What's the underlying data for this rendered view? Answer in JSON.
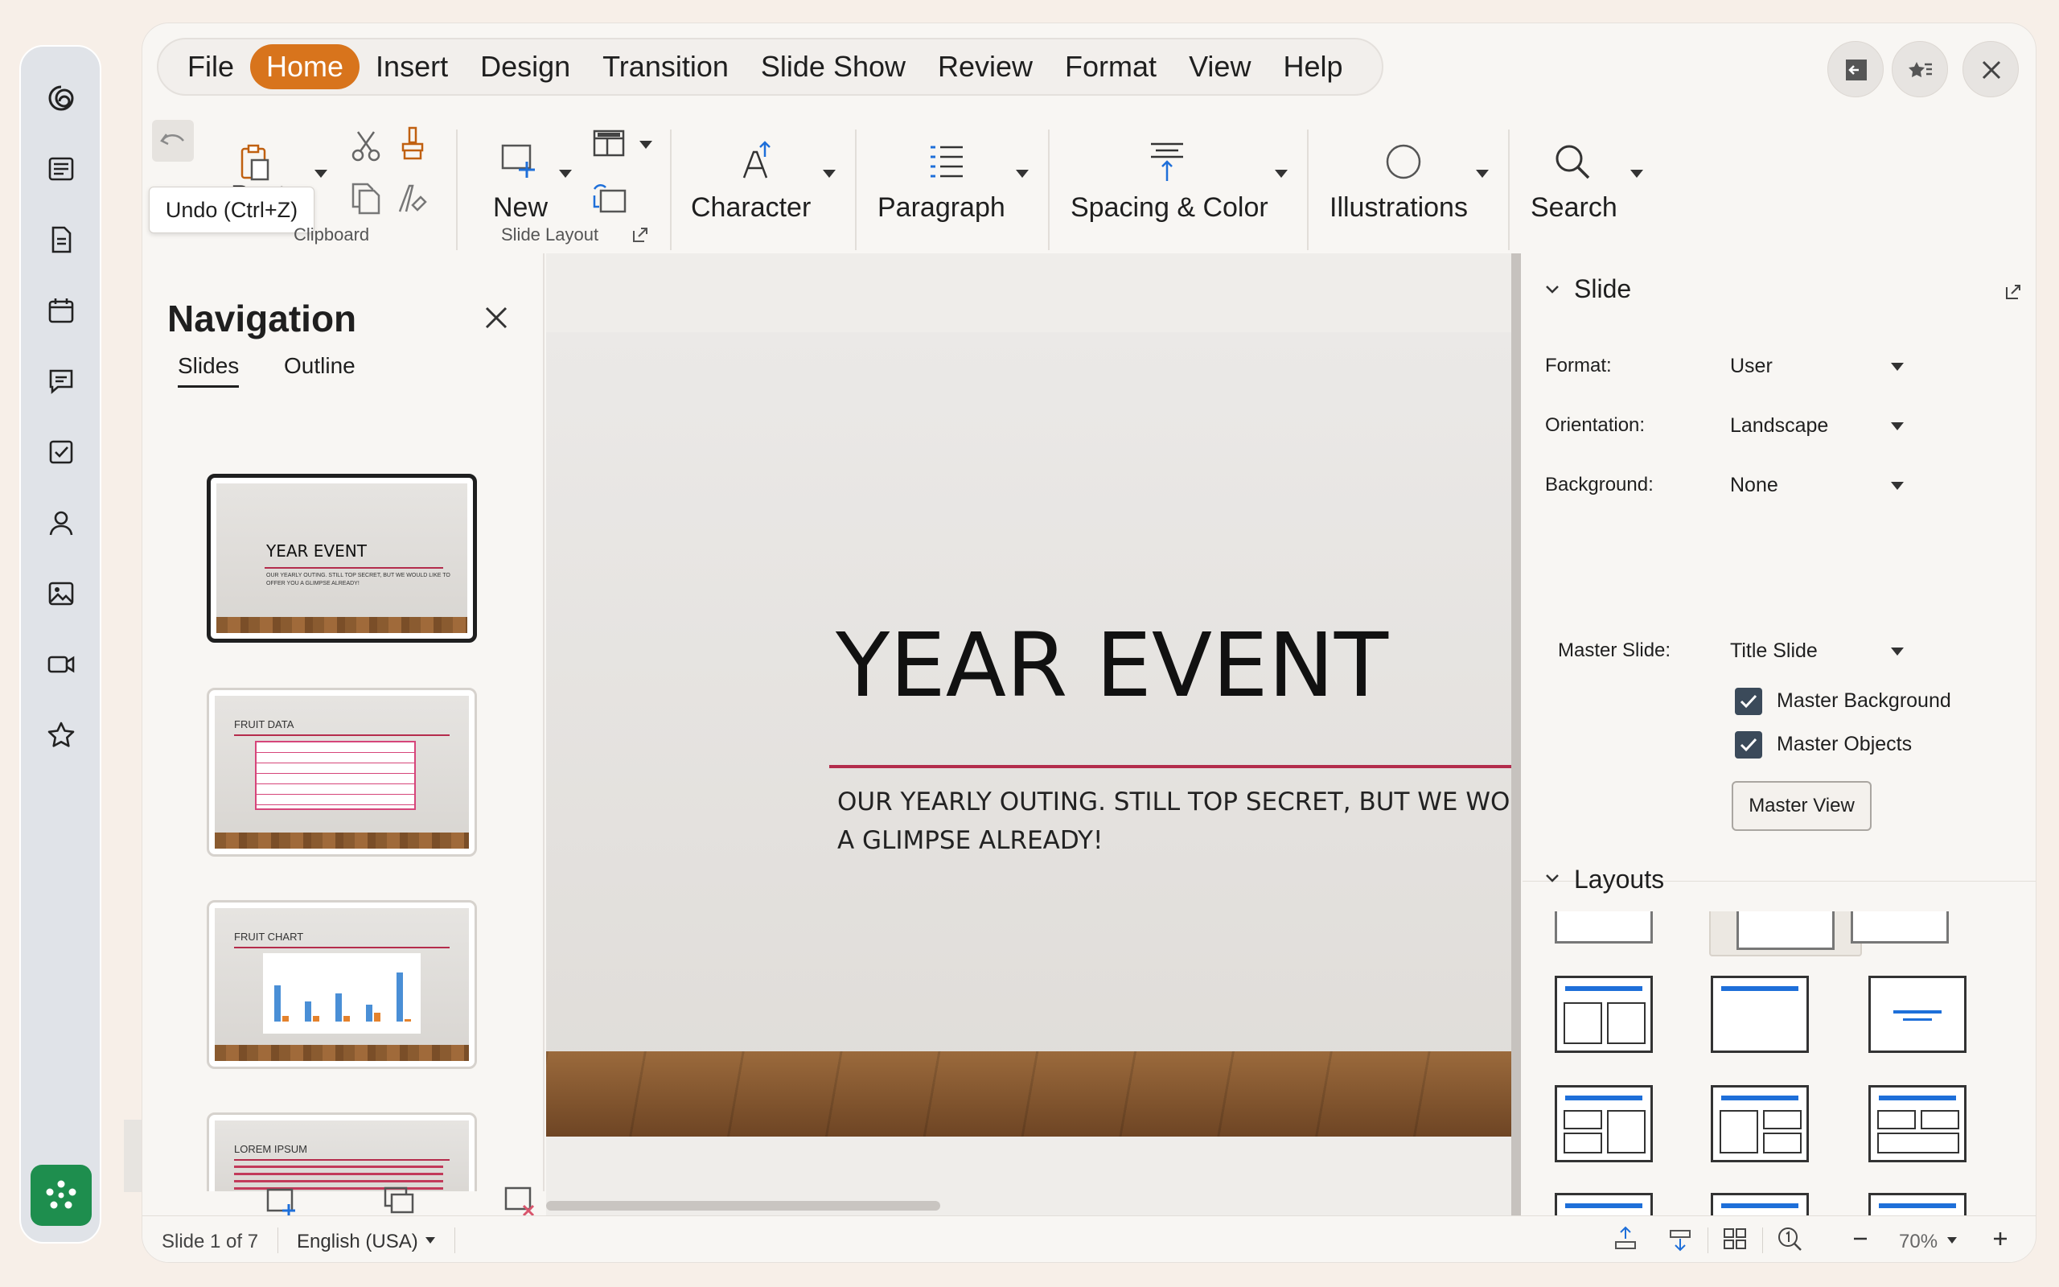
{
  "menu": [
    "File",
    "Home",
    "Insert",
    "Design",
    "Transition",
    "Slide Show",
    "Review",
    "Format",
    "View",
    "Help"
  ],
  "ribbon": {
    "paste": "Paste",
    "clipboard_group": "Clipboard",
    "new": "New",
    "slide_layout_group": "Slide Layout",
    "character": "Character",
    "paragraph": "Paragraph",
    "spacing_color": "Spacing & Color",
    "illustrations": "Illustrations",
    "search": "Search"
  },
  "tooltip": "Undo (Ctrl+Z)",
  "navigation": {
    "title": "Navigation",
    "tabs": [
      "Slides",
      "Outline"
    ],
    "thumbnails": [
      {
        "title": "YEAR EVENT",
        "subtitle": "OUR YEARLY OUTING. STILL TOP SECRET, BUT WE WOULD LIKE TO OFFER YOU A GLIMPSE ALREADY!"
      },
      {
        "title": "FRUIT DATA"
      },
      {
        "title": "FRUIT CHART"
      },
      {
        "title": "LOREM IPSUM"
      }
    ]
  },
  "slide": {
    "title": "YEAR EVENT",
    "subtitle_line1": "OUR YEARLY OUTING. STILL TOP SECRET, BUT WE WOU",
    "subtitle_line2": "A GLIMPSE ALREADY!"
  },
  "sidebar": {
    "slide_section": "Slide",
    "format_label": "Format:",
    "format_value": "User",
    "orientation_label": "Orientation:",
    "orientation_value": "Landscape",
    "background_label": "Background:",
    "background_value": "None",
    "master_slide_label": "Master Slide:",
    "master_slide_value": "Title Slide",
    "master_background": "Master Background",
    "master_objects": "Master Objects",
    "master_view": "Master View",
    "layouts_section": "Layouts"
  },
  "status": {
    "slide": "Slide 1 of 7",
    "language": "English (USA)",
    "zoom": "70%"
  },
  "colors": {
    "accent": "#d8741c",
    "fab": "#1e8e4e",
    "slide_line": "#b32c4c"
  }
}
